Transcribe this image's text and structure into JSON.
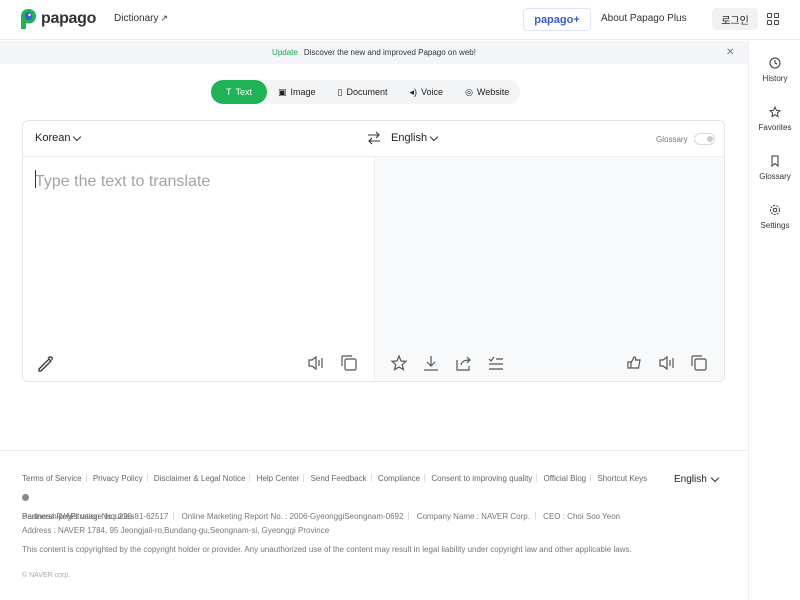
{
  "header": {
    "logo_text": "papago",
    "nav_dictionary": "Dictionary",
    "papago_plus": "papago+",
    "about_plus": "About Papago Plus",
    "login": "로그인"
  },
  "notice": {
    "tag": "Update",
    "message": "Discover the new and improved Papago on web!"
  },
  "tabs": [
    {
      "label": "Text",
      "icon": "text-icon"
    },
    {
      "label": "Image",
      "icon": "image-icon"
    },
    {
      "label": "Document",
      "icon": "document-icon"
    },
    {
      "label": "Voice",
      "icon": "voice-icon"
    },
    {
      "label": "Website",
      "icon": "globe-icon"
    }
  ],
  "translator": {
    "source_lang": "Korean",
    "target_lang": "English",
    "glossary_label": "Glossary",
    "placeholder": "Type the text to translate"
  },
  "side": {
    "history": "History",
    "favorites": "Favorites",
    "glossary": "Glossary",
    "settings": "Settings"
  },
  "footer": {
    "links": [
      "Terms of Service",
      "Privacy Policy",
      "Disclaimer & Legal Notice",
      "Help Center",
      "Send Feedback",
      "Compliance",
      "Consent to improving quality",
      "Official Blog",
      "Shortcut Keys",
      "Partnership/API usage inquiries"
    ],
    "language": "English",
    "business_reg": "Business Registration No : 220-81-62517",
    "online_marketing": "Online Marketing Report No. : 2006-GyeonggiSeongnam-0692",
    "company_name": "Company Name : NAVER Corp.",
    "ceo": "CEO : Choi Soo Yeon",
    "address": "Address : NAVER 1784, 95 Jeongjail-ro,Bundang-gu,Seongnam-si, Gyeonggi Province",
    "copyright": "This content is copyrighted by the copyright holder or provider. Any unauthorized use of the content may result in legal liability under copyright law and other applicable laws.",
    "naver_corp": "NAVER corp."
  },
  "colors": {
    "accent_green": "#1fb356",
    "plus_blue": "#3b5bdb"
  }
}
